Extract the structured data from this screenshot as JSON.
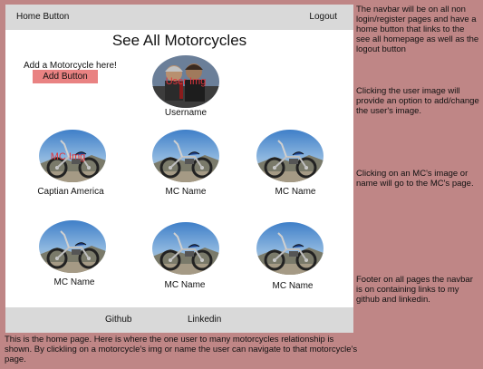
{
  "navbar": {
    "home_label": "Home Button",
    "logout_label": "Logout"
  },
  "page": {
    "title": "See All Motorcycles"
  },
  "add_section": {
    "prompt": "Add a Motorcycle here!",
    "button_label": "Add Button"
  },
  "user": {
    "image_overlay": "User Img",
    "username": "Username"
  },
  "motorcycles": [
    {
      "name": "Captian America",
      "image_overlay": "MC Img"
    },
    {
      "name": "MC Name"
    },
    {
      "name": "MC Name"
    },
    {
      "name": "MC Name"
    },
    {
      "name": "MC Name"
    },
    {
      "name": "MC Name"
    }
  ],
  "footer": {
    "github_label": "Github",
    "linkedin_label": "Linkedin"
  },
  "annotations": {
    "navbar_note": "The navbar will be on all non login/register pages and have a home button that links to the see all homepage as well as the logout button",
    "user_img_note": "Clicking the user image will provide an option to add/change the user's image.",
    "mc_note": "Clicking on an MC's image or name will go to the MC's page.",
    "footer_note": "Footer on all pages the navbar is on containing links to my github and linkedin.",
    "page_note": "This is the home page. Here is where the one user to many motorcycles relationship is shown. By clickling on a motorcycle's img or name the user can navigate to that motorcycle's page."
  },
  "colors": {
    "background": "#bf8686",
    "bars": "#d9d9d9",
    "add_button": "#e98282",
    "overlay_text": "#e0343c"
  }
}
